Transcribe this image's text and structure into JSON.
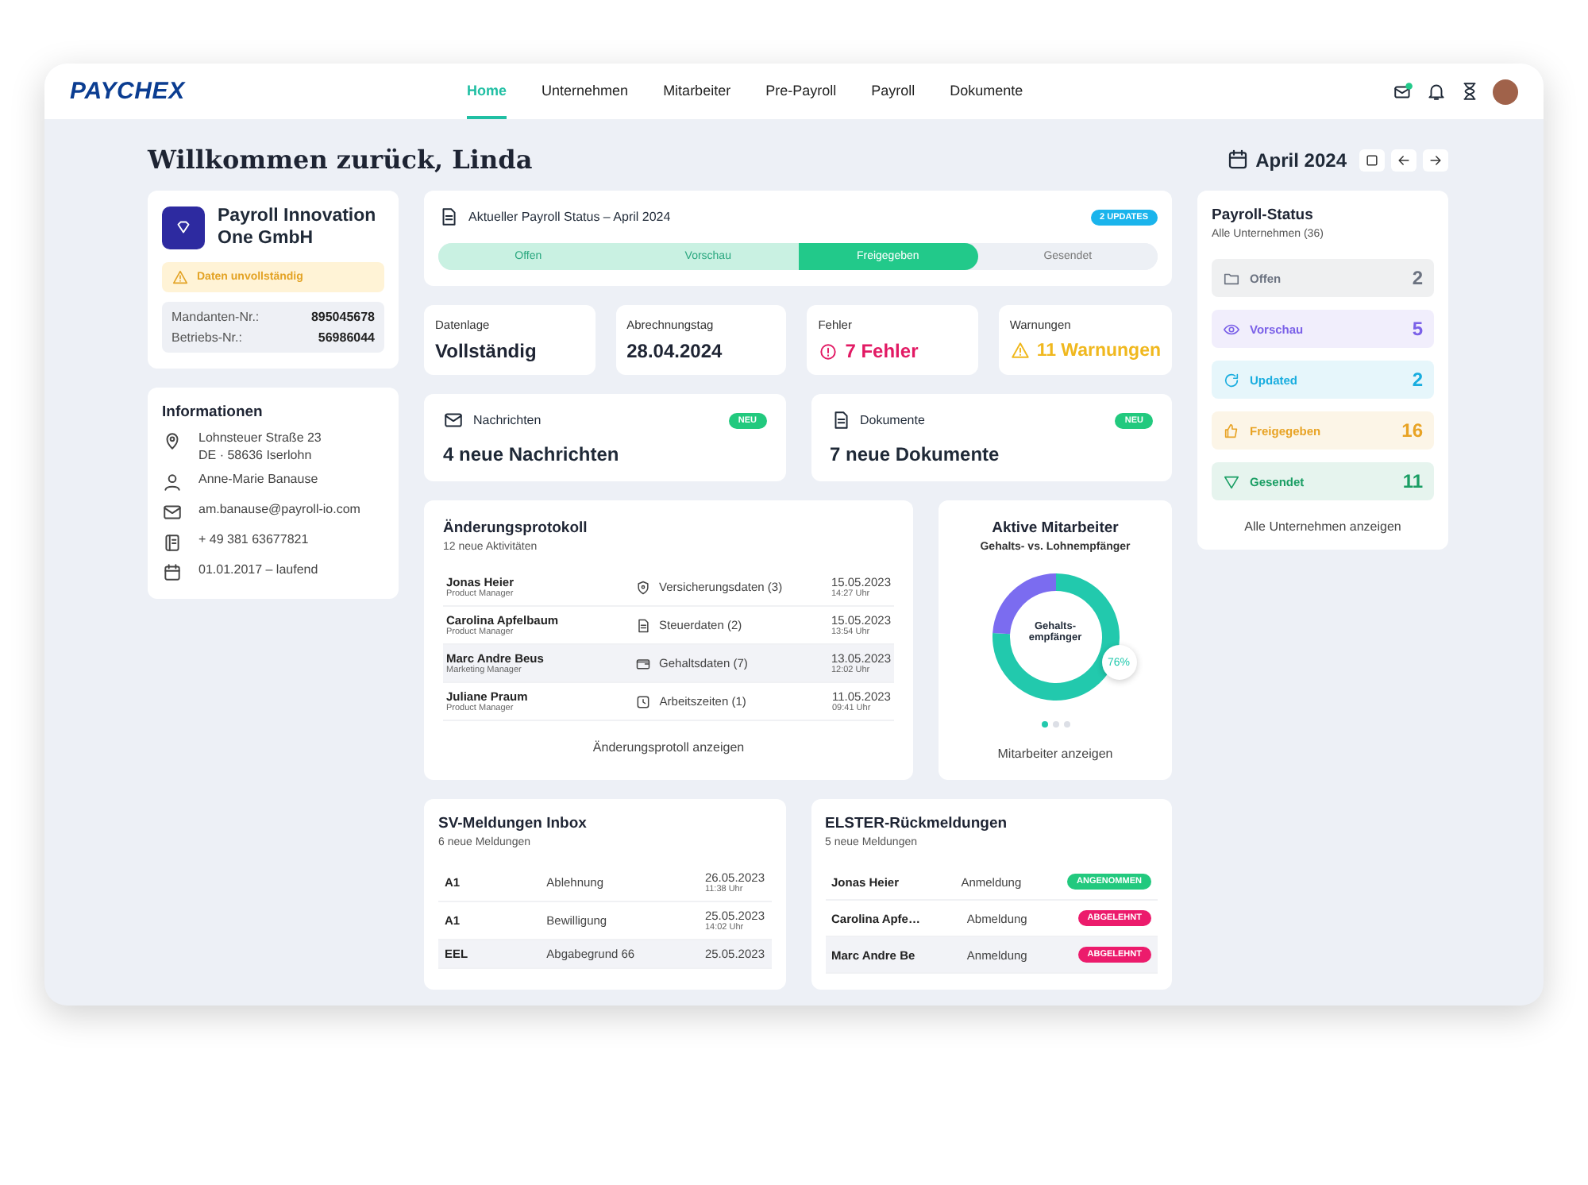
{
  "header": {
    "logo": "PAYCHEX",
    "nav": [
      {
        "label": "Home",
        "selected": true
      },
      {
        "label": "Unternehmen",
        "selected": false
      },
      {
        "label": "Mitarbeiter",
        "selected": false
      },
      {
        "label": "Pre-Payroll",
        "selected": false
      },
      {
        "label": "Payroll",
        "selected": false
      },
      {
        "label": "Dokumente",
        "selected": false
      }
    ]
  },
  "page": {
    "title": "Willkommen zurück, Linda",
    "month": "April 2024"
  },
  "company": {
    "name": "Payroll Innovation One GmbH",
    "warning": "Daten unvollständig",
    "ids": [
      {
        "label": "Mandanten-Nr.:",
        "value": "895045678"
      },
      {
        "label": "Betriebs-Nr.:",
        "value": "56986044"
      }
    ]
  },
  "info": {
    "title": "Informationen",
    "items": [
      {
        "kind": "location",
        "lines": [
          "Lohnsteuer Straße 23",
          "DE · 58636 Iserlohn"
        ]
      },
      {
        "kind": "person",
        "lines": [
          "Anne-Marie Banause"
        ]
      },
      {
        "kind": "mail",
        "lines": [
          "am.banause@payroll-io.com"
        ]
      },
      {
        "kind": "phone",
        "lines": [
          "+ 49 381 63677821"
        ]
      },
      {
        "kind": "calendar",
        "lines": [
          "01.01.2017 – laufend"
        ]
      }
    ]
  },
  "payroll_status": {
    "title": "Aktueller Payroll Status – April 2024",
    "badge": "2 UPDATES",
    "steps": [
      {
        "label": "Offen",
        "completed": true,
        "selected": false
      },
      {
        "label": "Vorschau",
        "completed": true,
        "selected": false
      },
      {
        "label": "Freigegeben",
        "completed": false,
        "selected": true
      },
      {
        "label": "Gesendet",
        "completed": false,
        "selected": false
      }
    ]
  },
  "stats": [
    {
      "label": "Datenlage",
      "value": "Vollständig",
      "kind": "plain"
    },
    {
      "label": "Abrechnungstag",
      "value": "28.04.2024",
      "kind": "plain"
    },
    {
      "label": "Fehler",
      "value": "7 Fehler",
      "kind": "error"
    },
    {
      "label": "Warnungen",
      "value": "11 Warnungen",
      "kind": "warning"
    }
  ],
  "news": [
    {
      "kind": "mail",
      "label": "Nachrichten",
      "badge": "NEU",
      "value": "4 neue Nachrichten"
    },
    {
      "kind": "document",
      "label": "Dokumente",
      "badge": "NEU",
      "value": "7 neue Dokumente"
    }
  ],
  "changelog": {
    "title": "Änderungsprotokoll",
    "subtitle": "12 neue Aktivitäten",
    "rows": [
      {
        "name": "Jonas Heier",
        "role": "Product Manager",
        "kind": "shield",
        "change": "Versicherungsdaten (3)",
        "date": "15.05.2023",
        "time": "14:27 Uhr",
        "selected": false
      },
      {
        "name": "Carolina Apfelbaum",
        "role": "Product Manager",
        "kind": "document",
        "change": "Steuerdaten (2)",
        "date": "15.05.2023",
        "time": "13:54 Uhr",
        "selected": false
      },
      {
        "name": "Marc Andre Beus",
        "role": "Marketing Manager",
        "kind": "wallet",
        "change": "Gehaltsdaten (7)",
        "date": "13.05.2023",
        "time": "12:02 Uhr",
        "selected": true
      },
      {
        "name": "Juliane Praum",
        "role": "Product Manager",
        "kind": "clock",
        "change": "Arbeitszeiten (1)",
        "date": "11.05.2023",
        "time": "09:41 Uhr",
        "selected": false
      }
    ],
    "link": "Änderungsprotoll anzeigen"
  },
  "employees": {
    "title": "Aktive Mitarbeiter",
    "subtitle": "Gehalts- vs. Lohnempfänger",
    "center_label": "Gehalts- empfänger",
    "percent_label": "76%",
    "chart_data": {
      "type": "donut",
      "values": [
        76,
        24
      ]
    },
    "dots": [
      {
        "selected": true
      },
      {
        "selected": false
      },
      {
        "selected": false
      }
    ],
    "link": "Mitarbeiter anzeigen"
  },
  "sv_inbox": {
    "title": "SV-Meldungen Inbox",
    "subtitle": "6 neue Meldungen",
    "rows": [
      {
        "type": "A1",
        "status": "Ablehnung",
        "date": "26.05.2023",
        "time": "11:38 Uhr",
        "selected": false
      },
      {
        "type": "A1",
        "status": "Bewilligung",
        "date": "25.05.2023",
        "time": "14:02 Uhr",
        "selected": false
      },
      {
        "type": "EEL",
        "status": "Abgabegrund 66",
        "date": "25.05.2023",
        "selected": true
      }
    ]
  },
  "elster": {
    "title": "ELSTER-Rückmeldungen",
    "subtitle": "5 neue Meldungen",
    "rows": [
      {
        "name": "Jonas Heier",
        "type": "Anmeldung",
        "badge": "ANGENOMMEN",
        "kind": "accepted",
        "selected": false
      },
      {
        "name": "Carolina Apfe…",
        "type": "Abmeldung",
        "badge": "ABGELEHNT",
        "kind": "rejected",
        "selected": false
      },
      {
        "name": "Marc Andre Be",
        "type": "Anmeldung",
        "badge": "ABGELEHNT",
        "kind": "rejected",
        "selected": true
      }
    ]
  },
  "status_overview": {
    "title": "Payroll-Status",
    "subtitle": "Alle Unternehmen (36)",
    "items": [
      {
        "kind": "folder",
        "label": "Offen",
        "count": "2",
        "color": "#6b7280"
      },
      {
        "kind": "eye",
        "label": "Vorschau",
        "count": "5",
        "color": "#7b61e8"
      },
      {
        "kind": "refresh",
        "label": "Updated",
        "count": "2",
        "color": "#19addf"
      },
      {
        "kind": "thumb",
        "label": "Freigegeben",
        "count": "16",
        "color": "#e8a325"
      },
      {
        "kind": "send",
        "label": "Gesendet",
        "count": "11",
        "color": "#1a9e64"
      }
    ],
    "link": "Alle Unternehmen anzeigen"
  }
}
